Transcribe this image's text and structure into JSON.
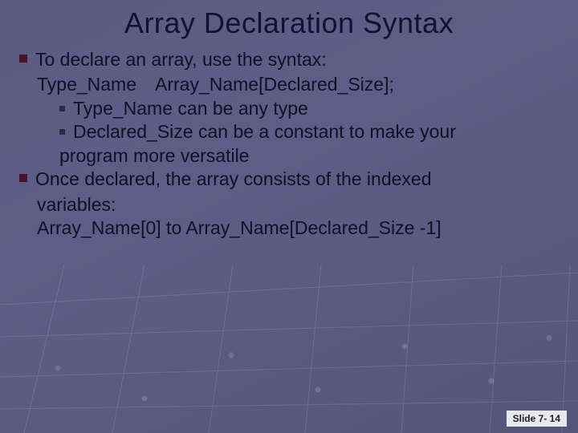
{
  "title": "Array Declaration Syntax",
  "bullet1_line1": "To declare an array, use the syntax:",
  "bullet1_line2": "Type_Name Array_Name[Declared_Size];",
  "sub1": "Type_Name can be any type",
  "sub2_line1": "Declared_Size can be a constant to make your",
  "sub2_line2": "program more versatile",
  "bullet2_line1": "Once declared, the array consists of the indexed",
  "bullet2_line2": "variables:",
  "bullet2_line3": "Array_Name[0] to Array_Name[Declared_Size -1]",
  "footer": "Slide 7- 14"
}
